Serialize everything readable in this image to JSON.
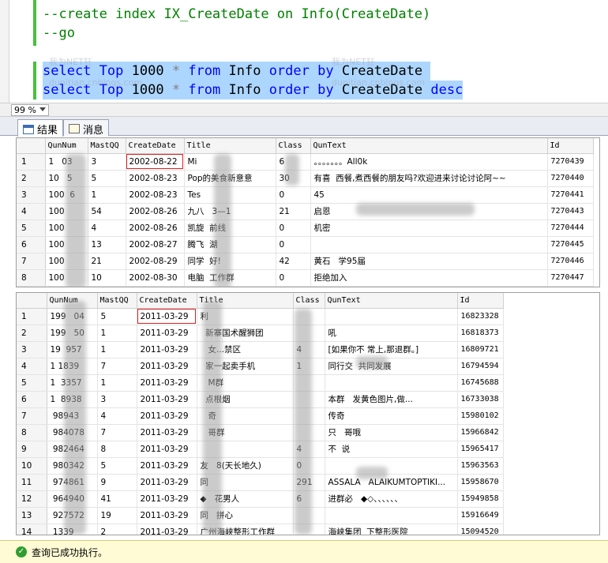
{
  "editor": {
    "lines": [
      {
        "parts": [
          {
            "t": "--create index IX_CreateDate on Info(CreateDate)",
            "c": "comment"
          }
        ]
      },
      {
        "parts": [
          {
            "t": "--go",
            "c": "comment"
          }
        ]
      },
      {
        "parts": []
      },
      {
        "selected": true,
        "parts": [
          {
            "t": "select",
            "c": "kw"
          },
          {
            "t": " ",
            "c": "ident"
          },
          {
            "t": "Top",
            "c": "kw"
          },
          {
            "t": " 1000 ",
            "c": "ident"
          },
          {
            "t": "*",
            "c": "op"
          },
          {
            "t": " ",
            "c": "ident"
          },
          {
            "t": "from",
            "c": "kw"
          },
          {
            "t": " Info ",
            "c": "ident"
          },
          {
            "t": "order by",
            "c": "kw"
          },
          {
            "t": " CreateDate ",
            "c": "ident"
          }
        ]
      },
      {
        "selected": true,
        "parts": [
          {
            "t": "select",
            "c": "kw"
          },
          {
            "t": " ",
            "c": "ident"
          },
          {
            "t": "Top",
            "c": "kw"
          },
          {
            "t": " 1000 ",
            "c": "ident"
          },
          {
            "t": "*",
            "c": "op"
          },
          {
            "t": " ",
            "c": "ident"
          },
          {
            "t": "from",
            "c": "kw"
          },
          {
            "t": " Info ",
            "c": "ident"
          },
          {
            "t": "order by",
            "c": "kw"
          },
          {
            "t": " CreateDate ",
            "c": "ident"
          },
          {
            "t": "desc",
            "c": "kw"
          }
        ]
      }
    ],
    "watermarks": [
      "我为NET狂",
      "dunitian.cnblogs.com"
    ]
  },
  "zoom": {
    "value": "99 %"
  },
  "tabs": [
    {
      "label": "结果",
      "icon": "grid-icon",
      "active": true
    },
    {
      "label": "消息",
      "icon": "message-icon",
      "active": false
    }
  ],
  "grid1": {
    "columns": [
      "QunNum",
      "MastQQ",
      "CreateDate",
      "Title",
      "Class",
      "QunText",
      "Id"
    ],
    "rows": [
      [
        "1",
        "1   03",
        "3",
        "2002-08-22",
        "Mi",
        "6",
        "。。。。。。。All0k",
        "7270439"
      ],
      [
        "2",
        "10   5",
        "5",
        "2002-08-23",
        "Pop的美食新意意",
        "30",
        "有喜  西餐,煮西餐的朋友吗?欢迎进来讨论讨论阿~~",
        "7270440"
      ],
      [
        "3",
        "100  6",
        "1",
        "2002-08-23",
        "Tes",
        "0",
        "45",
        "7270441"
      ],
      [
        "4",
        "100",
        "54",
        "2002-08-26",
        "九八   3—1",
        "21",
        "启恩",
        "7270443"
      ],
      [
        "5",
        "100",
        "4",
        "2002-08-26",
        "凯旋  前线",
        "0",
        "机密",
        "7270444"
      ],
      [
        "6",
        "100",
        "13",
        "2002-08-27",
        "腾飞  湖",
        "0",
        "",
        "7270445"
      ],
      [
        "7",
        "100",
        "21",
        "2002-08-29",
        "同学  好!",
        "42",
        "黄石   学95届",
        "7270446"
      ],
      [
        "8",
        "100",
        "10",
        "2002-08-30",
        "电脑  工作群",
        "0",
        "拒绝加入",
        "7270447"
      ]
    ],
    "highlight_cell": {
      "row": 0,
      "col": 3
    }
  },
  "grid2": {
    "columns": [
      "QunNum",
      "MastQQ",
      "CreateDate",
      "Title",
      "Class",
      "QunText",
      "Id"
    ],
    "rows": [
      [
        "1",
        "199   04",
        "5",
        "2011-03-29",
        "利",
        "",
        "",
        "16823328"
      ],
      [
        "2",
        "199   50",
        "1",
        "2011-03-29",
        "  新寨国术醒狮团",
        "",
        "吼",
        "16818373"
      ],
      [
        "3",
        "19  957",
        "1",
        "2011-03-29",
        "   女...禁区",
        "4",
        "[如果你不 常上,那退群。]",
        "16809721"
      ],
      [
        "4",
        "1 1839",
        "7",
        "2011-03-29",
        "  家一起卖手机",
        "1",
        "同行交  共同发展",
        "16794594"
      ],
      [
        "5",
        "1  3357",
        "1",
        "2011-03-29",
        "   M群",
        "",
        "",
        "16745688"
      ],
      [
        "6",
        "1  8938",
        "3",
        "2011-03-29",
        "  点根烟",
        "",
        "本群   发黄色图片,做...",
        "16733038"
      ],
      [
        "7",
        " 98943",
        "4",
        "2011-03-29",
        "   奇",
        "",
        "传奇",
        "15980102"
      ],
      [
        "8",
        " 984078",
        "7",
        "2011-03-29",
        "   哥群",
        "",
        "只   哥哦",
        "15966842"
      ],
      [
        "9",
        " 982464",
        "8",
        "2011-03-29",
        "",
        "4",
        "不  说",
        "15965417"
      ],
      [
        "10",
        " 980342",
        "5",
        "2011-03-29",
        "友   8(天长地久)",
        "0",
        "",
        "15963563"
      ],
      [
        "11",
        " 974861",
        "9",
        "2011-03-29",
        "同",
        "291",
        "ASSALA   ALAIKUMTOPTIKI...",
        "15958670"
      ],
      [
        "12",
        " 964940",
        "41",
        "2011-03-29",
        "◆   花男人",
        "6",
        "进群必   ◆◇、、、、、、",
        "15949858"
      ],
      [
        "13",
        " 927572",
        "19",
        "2011-03-29",
        "同   拼心",
        "",
        "",
        "15916649"
      ],
      [
        "14",
        " 1339",
        "2",
        "2011-03-29",
        "广州海峡整形工作群",
        "",
        "海峡集团  下整形医院",
        "15094520"
      ]
    ],
    "highlight_cell": {
      "row": 0,
      "col": 3
    }
  },
  "status": {
    "text": "查询已成功执行。"
  }
}
